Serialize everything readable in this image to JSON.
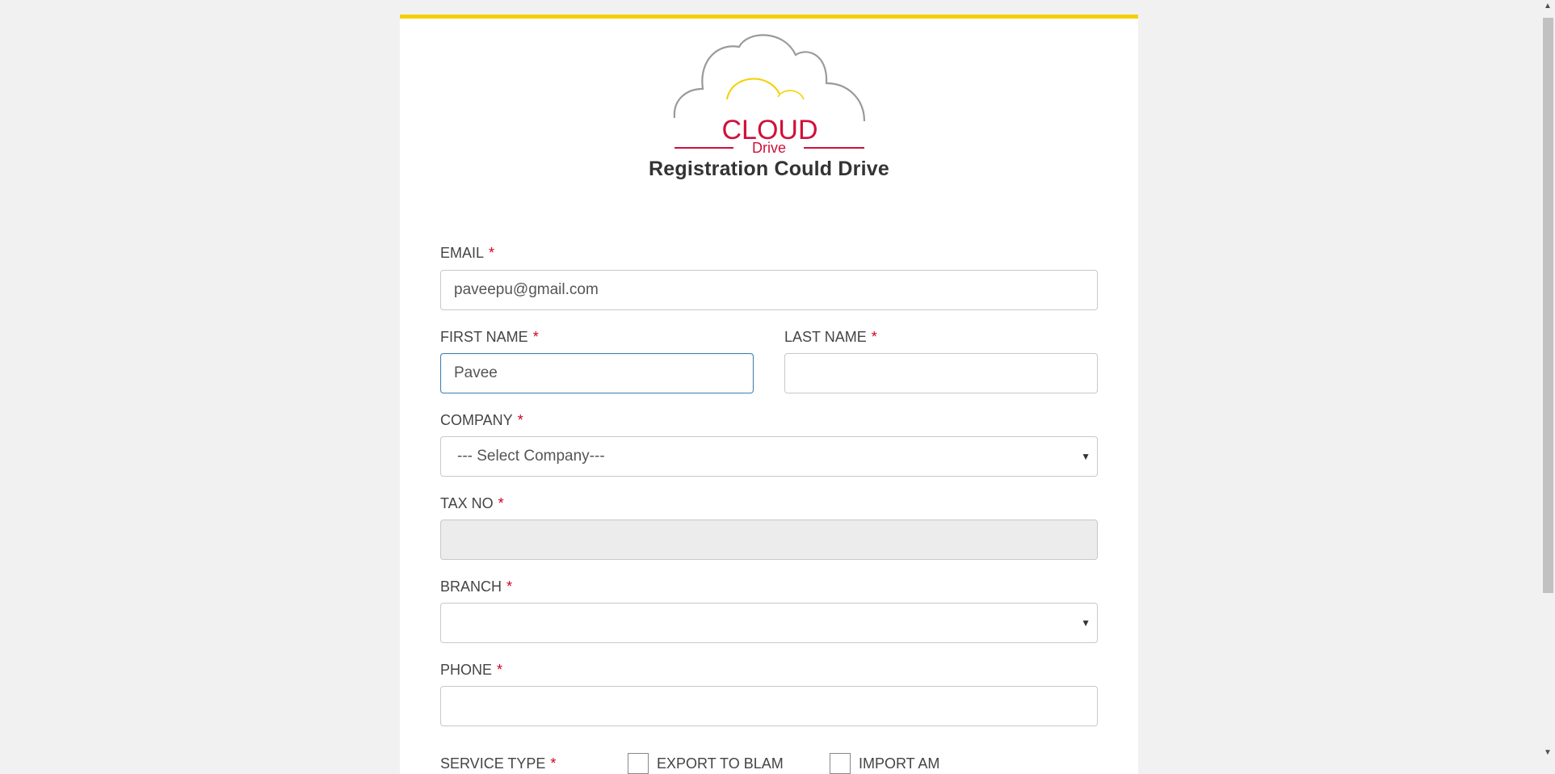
{
  "brand": {
    "logo_main": "CLOUD",
    "logo_sub": "Drive",
    "colors": {
      "accent_bar": "#f5d000",
      "logo_red": "#d0103a",
      "required": "#d0021b",
      "focus": "#3c7fb1"
    }
  },
  "form": {
    "title": "Registration Could Drive",
    "required_mark": "*",
    "email": {
      "label": "EMAIL",
      "value": "paveepu@gmail.com"
    },
    "first_name": {
      "label": "FIRST NAME",
      "value": "Pavee"
    },
    "last_name": {
      "label": "LAST NAME",
      "value": ""
    },
    "company": {
      "label": "COMPANY",
      "selected": "--- Select Company---"
    },
    "tax_no": {
      "label": "TAX NO",
      "value": ""
    },
    "branch": {
      "label": "BRANCH",
      "selected": ""
    },
    "phone": {
      "label": "PHONE",
      "value": ""
    },
    "service_type": {
      "label": "SERVICE TYPE",
      "options": [
        "EXPORT TO BLAM",
        "IMPORT AM"
      ]
    }
  },
  "icons": {
    "caret": "chevron-down-icon",
    "scroll_up": "arrow-up-icon",
    "scroll_down": "arrow-down-icon"
  }
}
